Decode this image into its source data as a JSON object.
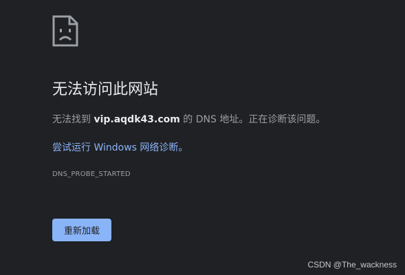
{
  "error": {
    "title": "无法访问此网站",
    "summary_prefix": "无法找到 ",
    "host": "vip.aqdk43.com",
    "summary_suffix": " 的 DNS 地址。正在诊断该问题。",
    "suggestion_link": "尝试运行 Windows 网络诊断。",
    "error_code": "DNS_PROBE_STARTED"
  },
  "buttons": {
    "reload_label": "重新加载"
  },
  "icons": {
    "main": "sad-document-icon"
  },
  "watermark": "CSDN @The_wackness",
  "colors": {
    "background": "#202124",
    "title": "#e8eaed",
    "body_text": "#9aa0a6",
    "link": "#8ab4f8",
    "button_bg": "#8ab4f8",
    "button_text": "#202124"
  }
}
